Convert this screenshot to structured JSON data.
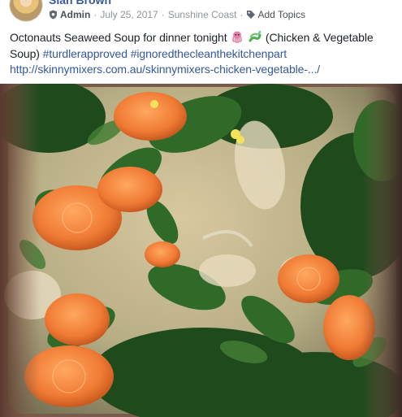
{
  "post": {
    "author": "Sian Brown",
    "role": "Admin",
    "date": "July 25, 2017",
    "location": "Sunshine Coast",
    "add_topics": "Add Topics",
    "message_start": "Octonauts Seaweed Soup for dinner tonight",
    "message_paren": "(Chicken & Vegetable",
    "message_line2_start": "Soup)",
    "hashtags": [
      "#turdlerapproved",
      "#ignoredthecleanthekitchenpart"
    ],
    "link_text": "http://skinnymixers.com.au/skinnymixers-chicken-vegetable-.../",
    "separator": "·",
    "icons": {
      "admin": "shield-icon",
      "topics": "tag-icon",
      "emoji_1": "octopus-emoji",
      "emoji_2": "seaweed-emoji"
    }
  },
  "colors": {
    "link": "#365899",
    "name": "#385898",
    "meta": "#90949c",
    "text": "#1d2129"
  }
}
